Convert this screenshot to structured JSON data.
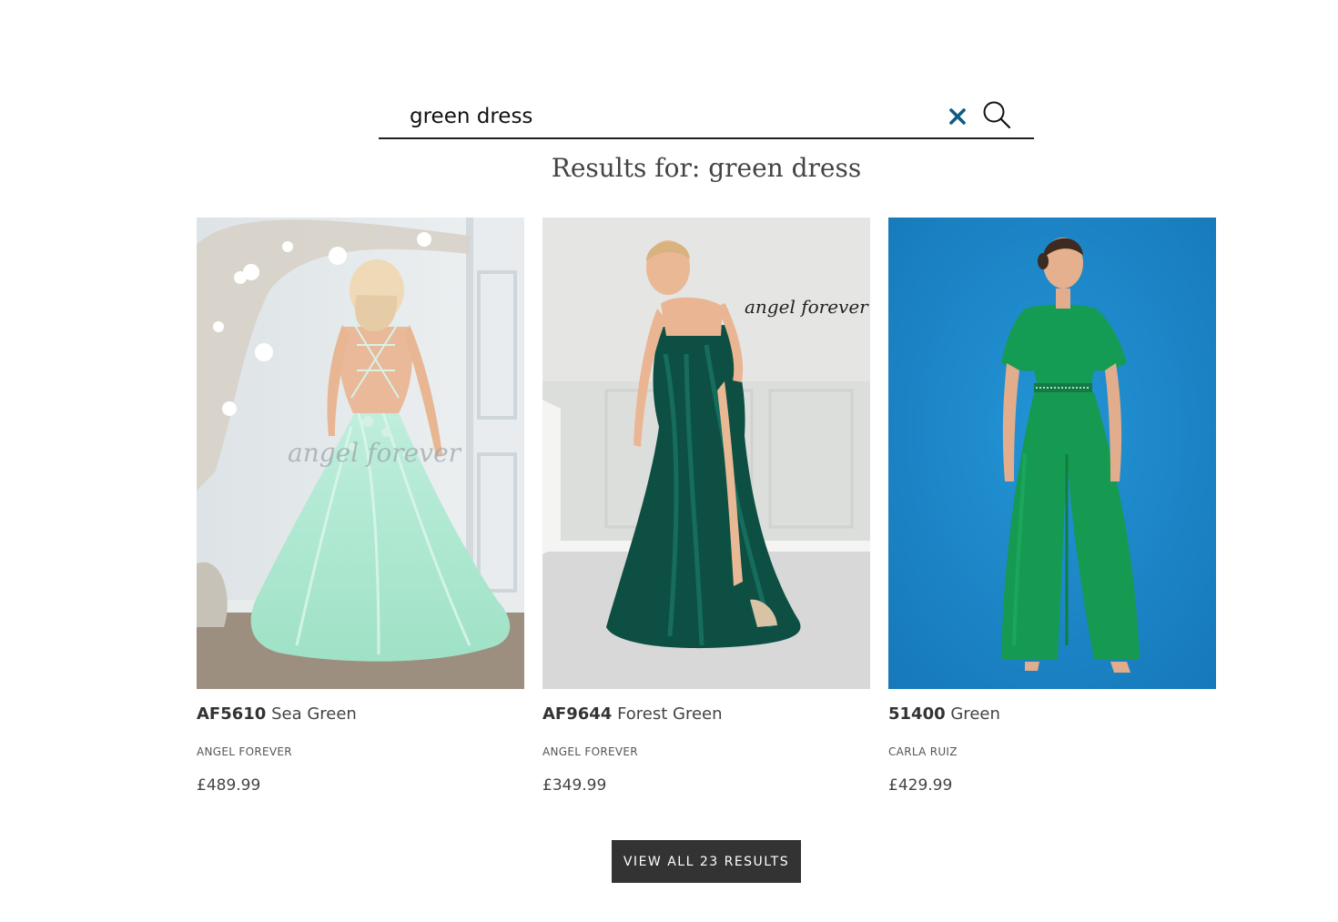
{
  "search": {
    "value": "green dress",
    "clear_icon": "close-icon",
    "submit_icon": "search-icon",
    "clear_color": "#0d5c86"
  },
  "results": {
    "title": "Results for: green dress"
  },
  "products": [
    {
      "code": "AF5610",
      "color_name": "Sea Green",
      "brand": "ANGEL FOREVER",
      "price": "£489.99",
      "image_watermark": "angel forever"
    },
    {
      "code": "AF9644",
      "color_name": "Forest Green",
      "brand": "ANGEL FOREVER",
      "price": "£349.99",
      "image_watermark": "angel forever"
    },
    {
      "code": "51400",
      "color_name": "Green",
      "brand": "CARLA RUIZ",
      "price": "£429.99"
    }
  ],
  "view_all": {
    "label": "VIEW ALL 23 RESULTS"
  },
  "colors": {
    "button_bg": "#333333",
    "text": "#333333"
  }
}
